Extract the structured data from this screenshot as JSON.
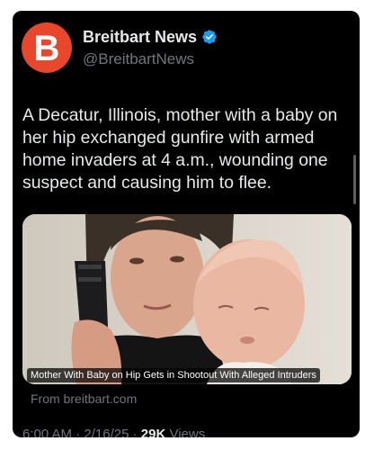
{
  "post": {
    "display_name": "Breitbart News",
    "handle": "@BreitbartNews",
    "avatar_letter": "B",
    "text": "A Decatur, Illinois, mother with a baby on her hip exchanged gunfire with armed home invaders at 4 a.m., wounding one suspect and causing him to flee.",
    "media_caption": "Mother With Baby on Hip Gets in Shootout With Alleged Intruders",
    "source_label": "From breitbart.com",
    "time": "6:00 AM",
    "separator": "·",
    "date": "2/16/25",
    "views_count": "29K",
    "views_label": "Views"
  },
  "colors": {
    "background": "#000000",
    "brand_red": "#e8472c",
    "verified_blue": "#1d9bf0",
    "text_primary": "#e7e9ea",
    "text_secondary": "#71767b"
  },
  "icons": {
    "verified": "verified-badge-icon"
  }
}
